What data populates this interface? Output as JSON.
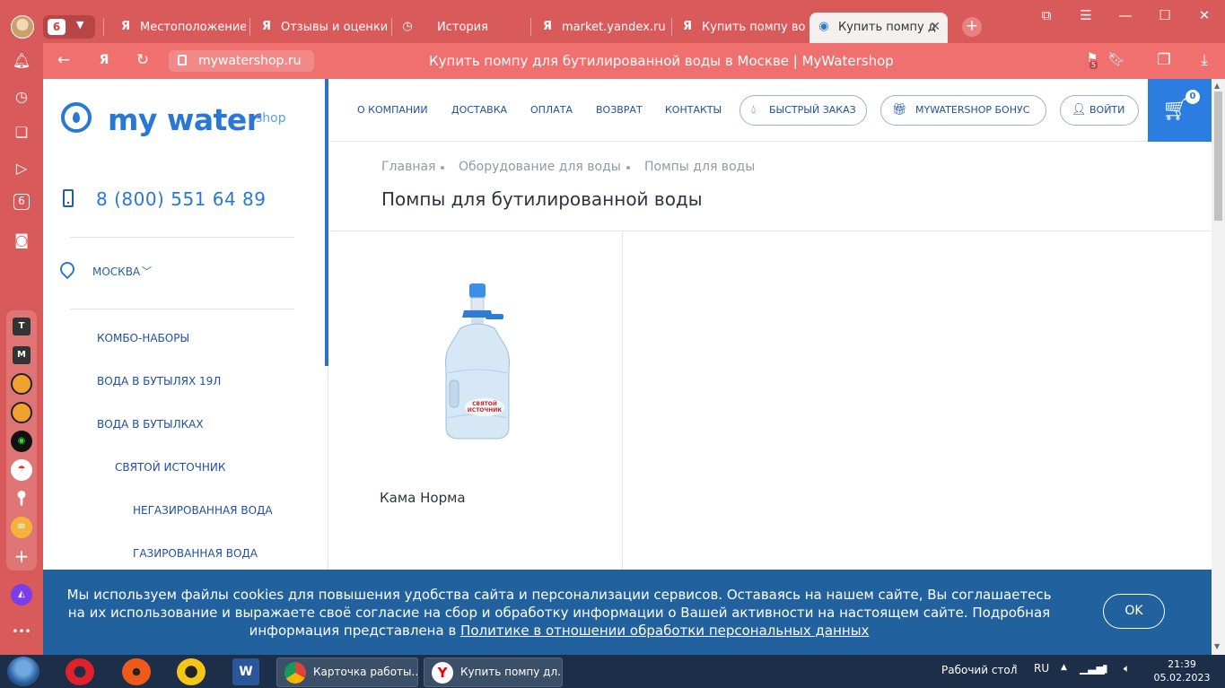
{
  "browser": {
    "tab_count": "6",
    "tabs": [
      {
        "label": "Местоположение",
        "icon": "Я"
      },
      {
        "label": "Отзывы и оценки",
        "icon": "Я"
      },
      {
        "label": "История",
        "icon": "clock-icon"
      },
      {
        "label": "market.yandex.ru –",
        "icon": "Я"
      },
      {
        "label": "Купить помпу вод",
        "icon": "Я"
      },
      {
        "label": "Купить помпу д",
        "icon": "water-drop-icon",
        "active": true
      }
    ],
    "url": "mywatershop.ru",
    "page_title": "Купить помпу для бутилированной воды в Москве | MyWatershop",
    "extension_badge": "5",
    "sidebar_badge": "6"
  },
  "site": {
    "logo_text": "my water",
    "logo_sub": "shop",
    "phone": "8 (800) 551 64 89",
    "city": "МОСКВА",
    "nav": [
      "О КОМПАНИИ",
      "ДОСТАВКА",
      "ОПЛАТА",
      "ВОЗВРАТ",
      "КОНТАКТЫ"
    ],
    "quick_order": "БЫСТРЫЙ ЗАКАЗ",
    "bonus": "MYWATERSHOP БОНУС",
    "login": "ВОЙТИ",
    "cart_count": "0",
    "categories": [
      {
        "label": "КОМБО-НАБОРЫ",
        "level": 0
      },
      {
        "label": "ВОДА В БУТЫЛЯХ 19Л",
        "level": 0
      },
      {
        "label": "ВОДА В БУТЫЛКАХ",
        "level": 0
      },
      {
        "label": "СВЯТОЙ ИСТОЧНИК",
        "level": 1
      },
      {
        "label": "НЕГАЗИРОВАННАЯ ВОДА",
        "level": 2
      },
      {
        "label": "ГАЗИРОВАННАЯ ВОДА",
        "level": 2
      }
    ],
    "breadcrumbs": [
      "Главная",
      "Оборудование для воды",
      "Помпы для воды"
    ],
    "heading": "Помпы для бутилированной воды",
    "product": {
      "name": "Кама Норма",
      "bottle_label": "СВЯТОЙ ИСТОЧНИК"
    },
    "cookie": {
      "text": "Мы используем файлы cookies для повышения удобства сайта и персонализации сервисов. Оставаясь на нашем сайте, Вы соглашаетесь на их использование и выражаете своё согласие на сбор и обработку информации о Вашей активности на настоящем сайте. Подробная информация представлена в ",
      "link": "Политике в отношении обработки персональных данных",
      "ok": "OK"
    }
  },
  "taskbar": {
    "tasks": [
      "Карточка работы...",
      "Купить помпу дл..."
    ],
    "desktop_label": "Рабочий стол",
    "lang": "RU",
    "time": "21:39",
    "date": "05.02.2023"
  },
  "colors": {
    "brand_blue": "#2a78d6",
    "browser_red": "#d95a5a",
    "cookie_bg": "#21629e"
  }
}
